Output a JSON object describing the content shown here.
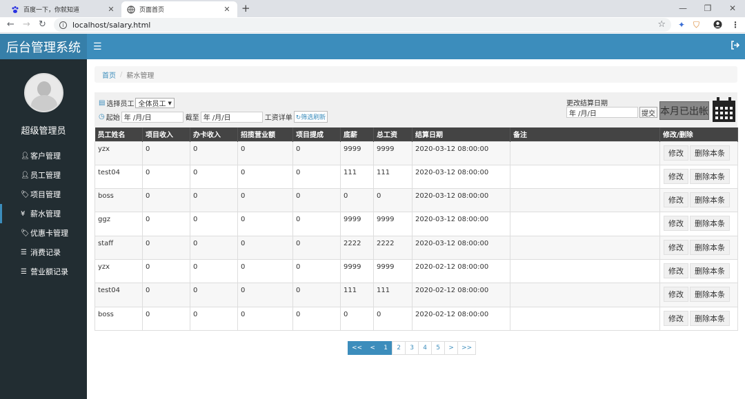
{
  "browser": {
    "tabs": [
      {
        "title": "百度一下，你就知道",
        "active": false
      },
      {
        "title": "页面首页",
        "active": true
      }
    ],
    "url": "localhost/salary.html"
  },
  "header": {
    "app_title": "后台管理系统"
  },
  "sidebar": {
    "user_name": "超级管理员",
    "items": [
      {
        "label": "客户管理",
        "icon": "user-icon"
      },
      {
        "label": "员工管理",
        "icon": "user-icon"
      },
      {
        "label": "项目管理",
        "icon": "tag-icon"
      },
      {
        "label": "薪水管理",
        "icon": "yen-icon",
        "active": true
      },
      {
        "label": "优惠卡管理",
        "icon": "tag-icon"
      },
      {
        "label": "消费记录",
        "icon": "list-icon"
      },
      {
        "label": "营业额记录",
        "icon": "list-icon"
      }
    ]
  },
  "breadcrumb": {
    "home": "首页",
    "separator": "/",
    "current": "薪水管理"
  },
  "filters": {
    "employee_label": "选择员工",
    "employee_value": "全体员工",
    "start_label": "起始",
    "start_value": "年 /月/日",
    "end_label": "截至",
    "end_value": "年 /月/日",
    "detail_label": "工资详单",
    "refresh_label": "筛选刷新",
    "settle_date_label": "更改结算日期",
    "settle_date_value": "年 /月/日",
    "submit_label": "提交",
    "settle_button": "本月已出帐"
  },
  "table": {
    "headers": [
      "员工姓名",
      "项目收入",
      "办卡收入",
      "招揽营业额",
      "项目提成",
      "底薪",
      "总工资",
      "结算日期",
      "备注",
      "修改/删除"
    ],
    "edit_label": "修改",
    "delete_label": "删除本条",
    "rows": [
      {
        "name": "yzx",
        "project_income": "0",
        "card_income": "0",
        "solicit": "0",
        "commission": "0",
        "base": "9999",
        "total": "9999",
        "date": "2020-03-12 08:00:00",
        "note": ""
      },
      {
        "name": "test04",
        "project_income": "0",
        "card_income": "0",
        "solicit": "0",
        "commission": "0",
        "base": "111",
        "total": "111",
        "date": "2020-03-12 08:00:00",
        "note": ""
      },
      {
        "name": "boss",
        "project_income": "0",
        "card_income": "0",
        "solicit": "0",
        "commission": "0",
        "base": "0",
        "total": "0",
        "date": "2020-03-12 08:00:00",
        "note": ""
      },
      {
        "name": "ggz",
        "project_income": "0",
        "card_income": "0",
        "solicit": "0",
        "commission": "0",
        "base": "9999",
        "total": "9999",
        "date": "2020-03-12 08:00:00",
        "note": ""
      },
      {
        "name": "staff",
        "project_income": "0",
        "card_income": "0",
        "solicit": "0",
        "commission": "0",
        "base": "2222",
        "total": "2222",
        "date": "2020-03-12 08:00:00",
        "note": ""
      },
      {
        "name": "yzx",
        "project_income": "0",
        "card_income": "0",
        "solicit": "0",
        "commission": "0",
        "base": "9999",
        "total": "9999",
        "date": "2020-02-12 08:00:00",
        "note": ""
      },
      {
        "name": "test04",
        "project_income": "0",
        "card_income": "0",
        "solicit": "0",
        "commission": "0",
        "base": "111",
        "total": "111",
        "date": "2020-02-12 08:00:00",
        "note": ""
      },
      {
        "name": "boss",
        "project_income": "0",
        "card_income": "0",
        "solicit": "0",
        "commission": "0",
        "base": "0",
        "total": "0",
        "date": "2020-02-12 08:00:00",
        "note": ""
      }
    ]
  },
  "pagination": {
    "items": [
      "<<",
      "<",
      "1",
      "2",
      "3",
      "4",
      "5",
      ">",
      ">>"
    ],
    "current": "1"
  },
  "colors": {
    "brand": "#3c8dbc",
    "sidebar": "#222d32",
    "table_header": "#444444"
  }
}
